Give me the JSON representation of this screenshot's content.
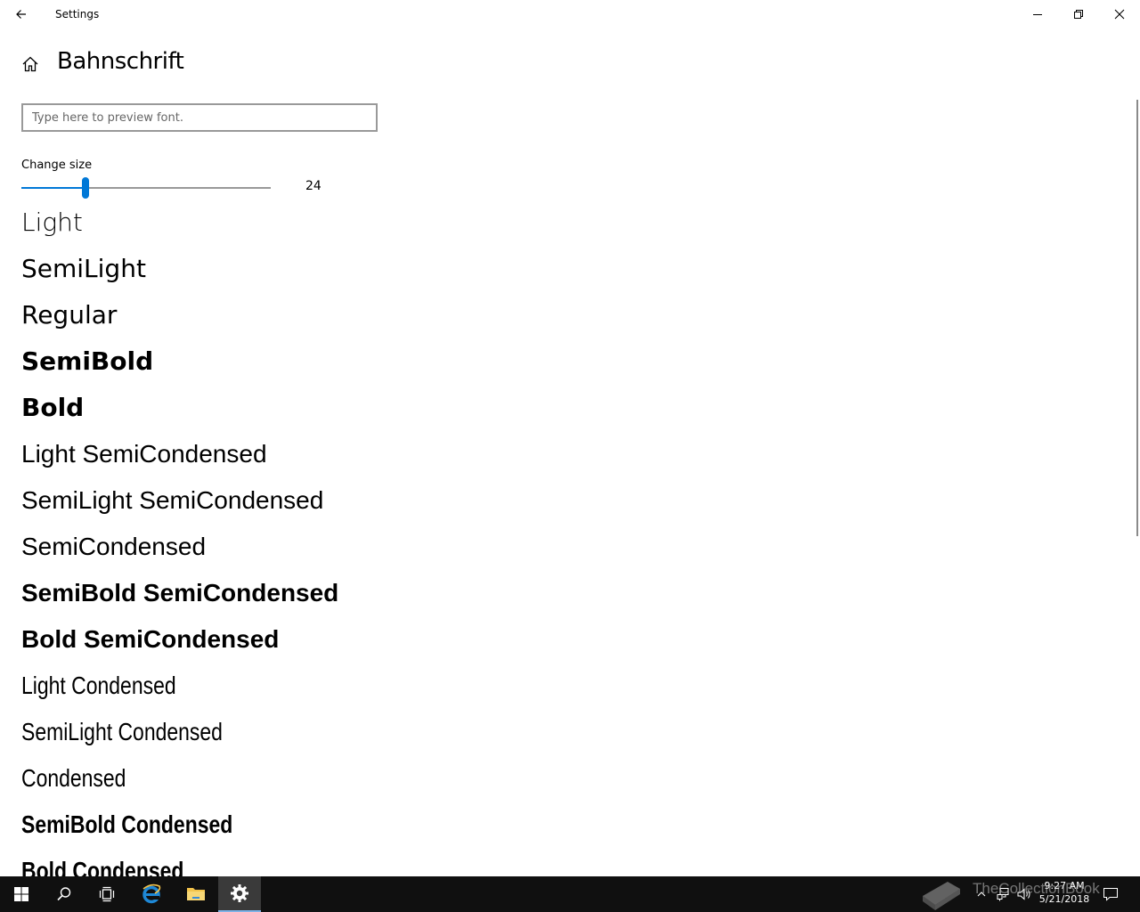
{
  "window": {
    "title": "Settings"
  },
  "header": {
    "title": "Bahnschrift"
  },
  "preview": {
    "placeholder": "Type here to preview font.",
    "value": ""
  },
  "size": {
    "label": "Change size",
    "value": "24",
    "slider_fraction": 0.257
  },
  "styles": [
    "Light",
    "SemiLight",
    "Regular",
    "SemiBold",
    "Bold",
    "Light SemiCondensed",
    "SemiLight SemiCondensed",
    "SemiCondensed",
    "SemiBold SemiCondensed",
    "Bold SemiCondensed",
    "Light Condensed",
    "SemiLight Condensed",
    "Condensed",
    "SemiBold Condensed",
    "Bold Condensed"
  ],
  "taskbar": {
    "items": [
      "start-button",
      "search-button",
      "task-view-button",
      "internet-explorer",
      "file-explorer",
      "settings"
    ],
    "active": "settings",
    "time": "9:27 AM",
    "date": "5/21/2018"
  },
  "watermark": {
    "text": "TheCollectionBook"
  },
  "colors": {
    "accent": "#0078d7",
    "taskbar": "#101010",
    "ie_blue": "#1e88d6",
    "folder_yellow": "#f3c34b"
  }
}
